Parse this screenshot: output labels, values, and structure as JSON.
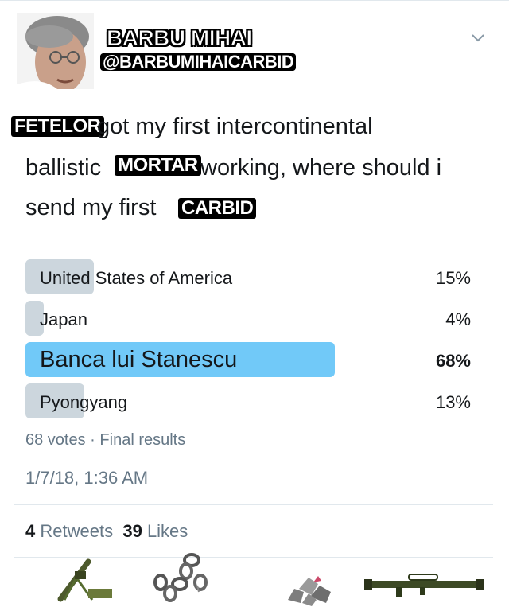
{
  "header": {
    "display_name": "BARBU MIHAI",
    "handle": "@BARBUMIHAICARBID",
    "avatar_icon": "person-photo-icon",
    "menu_icon": "chevron-down-icon"
  },
  "tweet": {
    "label_top": "FETELOR",
    "line1": "got my first intercontinental",
    "line2_start": "ballistic",
    "label_mid": "MORTAR",
    "line2_end": "working, where should i",
    "line3": "send my first",
    "label_end": "CARBID"
  },
  "poll": {
    "options": [
      {
        "label": "United States of America",
        "percent": "15%",
        "fraction": 0.15
      },
      {
        "label": "Japan",
        "percent": "4%",
        "fraction": 0.04
      },
      {
        "label": "Banca lui Stanescu",
        "percent": "68%",
        "fraction": 0.68
      },
      {
        "label": "Pyongyang",
        "percent": "13%",
        "fraction": 0.13
      }
    ],
    "votes": "68 votes",
    "separator": "·",
    "status": "Final results"
  },
  "timestamp": "1/7/18, 1:36 AM",
  "engagement": {
    "retweet_count": "4",
    "retweet_label": "Retweets",
    "like_count": "39",
    "like_label": "Likes"
  },
  "action_icons": [
    "mortar-icon",
    "chain-icon",
    "carbide-rocks-icon",
    "bazooka-icon"
  ],
  "colors": {
    "winner_bar": "#71c9f8",
    "bar": "#ccd6dd",
    "muted_text": "#657786"
  }
}
